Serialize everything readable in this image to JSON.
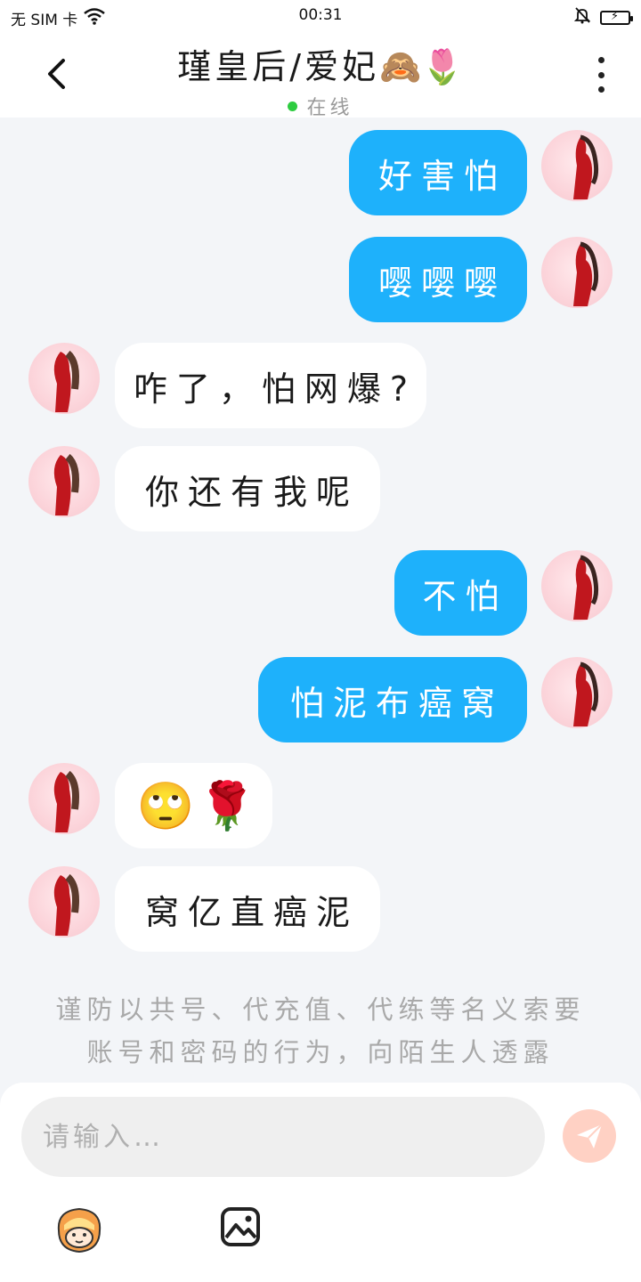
{
  "status_bar": {
    "carrier": "无 SIM 卡",
    "time": "00:31",
    "icons": [
      "wifi-icon",
      "bell-off-icon",
      "battery-charging-icon"
    ]
  },
  "header": {
    "back_icon": "chevron-left-icon",
    "title": "瑾皇后/爱妃",
    "title_emoji": "🙈🌷",
    "status": "在线",
    "status_color": "#2ecc40",
    "more_icon": "more-vertical-icon"
  },
  "messages": [
    {
      "side": "me",
      "text": "好害怕"
    },
    {
      "side": "me",
      "text": "嘤嘤嘤"
    },
    {
      "side": "them",
      "text": "咋了，怕网爆?"
    },
    {
      "side": "them",
      "text": "你还有我呢"
    },
    {
      "side": "me",
      "text": "不怕"
    },
    {
      "side": "me",
      "text": "怕泥布癌窝"
    },
    {
      "side": "them",
      "text": "🙄🌹"
    },
    {
      "side": "them",
      "text": "窝亿直癌泥"
    }
  ],
  "notice": "谨防以共号、代充值、代练等名义索要账号和密码的行为，向陌生人透露",
  "composer": {
    "placeholder": "请输入…",
    "send_icon": "paper-plane-icon",
    "sticker_icon": "sticker-face-icon",
    "image_icon": "image-icon"
  },
  "colors": {
    "my_bubble": "#1eb1fb",
    "their_bubble": "#ffffff",
    "background": "#f3f5f8",
    "send_button": "#ffd1c4"
  }
}
